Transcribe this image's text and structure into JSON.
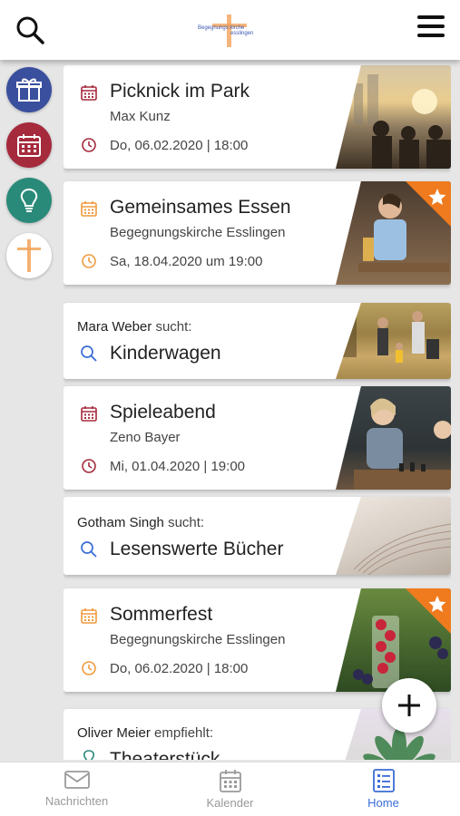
{
  "header": {
    "logo_text_left": "Begegnungs kirche",
    "logo_text_right": "esslingen",
    "search_icon": "search-icon",
    "menu_icon": "hamburger-menu-icon"
  },
  "sidebar": {
    "items": [
      {
        "icon": "gift-icon",
        "color": "#3a4f9e"
      },
      {
        "icon": "calendar-icon",
        "color": "#a52a3c"
      },
      {
        "icon": "lightbulb-icon",
        "color": "#2a8a7a"
      },
      {
        "icon": "church-cross-icon",
        "color": "#ffffff"
      }
    ]
  },
  "feed": {
    "cards": [
      {
        "type": "event",
        "title": "Picknick im Park",
        "organizer": "Max Kunz",
        "date": "Do, 06.02.2020 | 18:00",
        "accent": "#a52a3c",
        "featured": false
      },
      {
        "type": "event",
        "title": "Gemeinsames Essen",
        "organizer": "Begegnungskirche Esslingen",
        "date": "Sa, 18.04.2020 um 19:00",
        "accent": "#f09a3e",
        "featured": true
      },
      {
        "type": "search",
        "person": "Mara Weber",
        "verb": "sucht:",
        "title": "Kinderwagen"
      },
      {
        "type": "event",
        "title": "Spieleabend",
        "organizer": "Zeno Bayer",
        "date": "Mi, 01.04.2020 | 19:00",
        "accent": "#a52a3c",
        "featured": false
      },
      {
        "type": "search",
        "person": "Gotham Singh",
        "verb": "sucht:",
        "title": "Lesenswerte Bücher"
      },
      {
        "type": "event",
        "title": "Sommerfest",
        "organizer": "Begegnungskirche Esslingen",
        "date": "Do, 06.02.2020 | 18:00",
        "accent": "#f09a3e",
        "featured": true
      },
      {
        "type": "recommend",
        "person": "Oliver Meier",
        "verb": "empfiehlt:",
        "title": "Theaterstück"
      }
    ]
  },
  "fab": {
    "icon": "plus-icon"
  },
  "bottom_nav": {
    "tabs": [
      {
        "label": "Nachrichten",
        "icon": "envelope-icon",
        "active": false
      },
      {
        "label": "Kalender",
        "icon": "calendar-icon",
        "active": false
      },
      {
        "label": "Home",
        "icon": "home-list-icon",
        "active": true
      }
    ]
  },
  "colors": {
    "accent_blue": "#3a6cd6",
    "star_orange": "#f07a1e"
  }
}
